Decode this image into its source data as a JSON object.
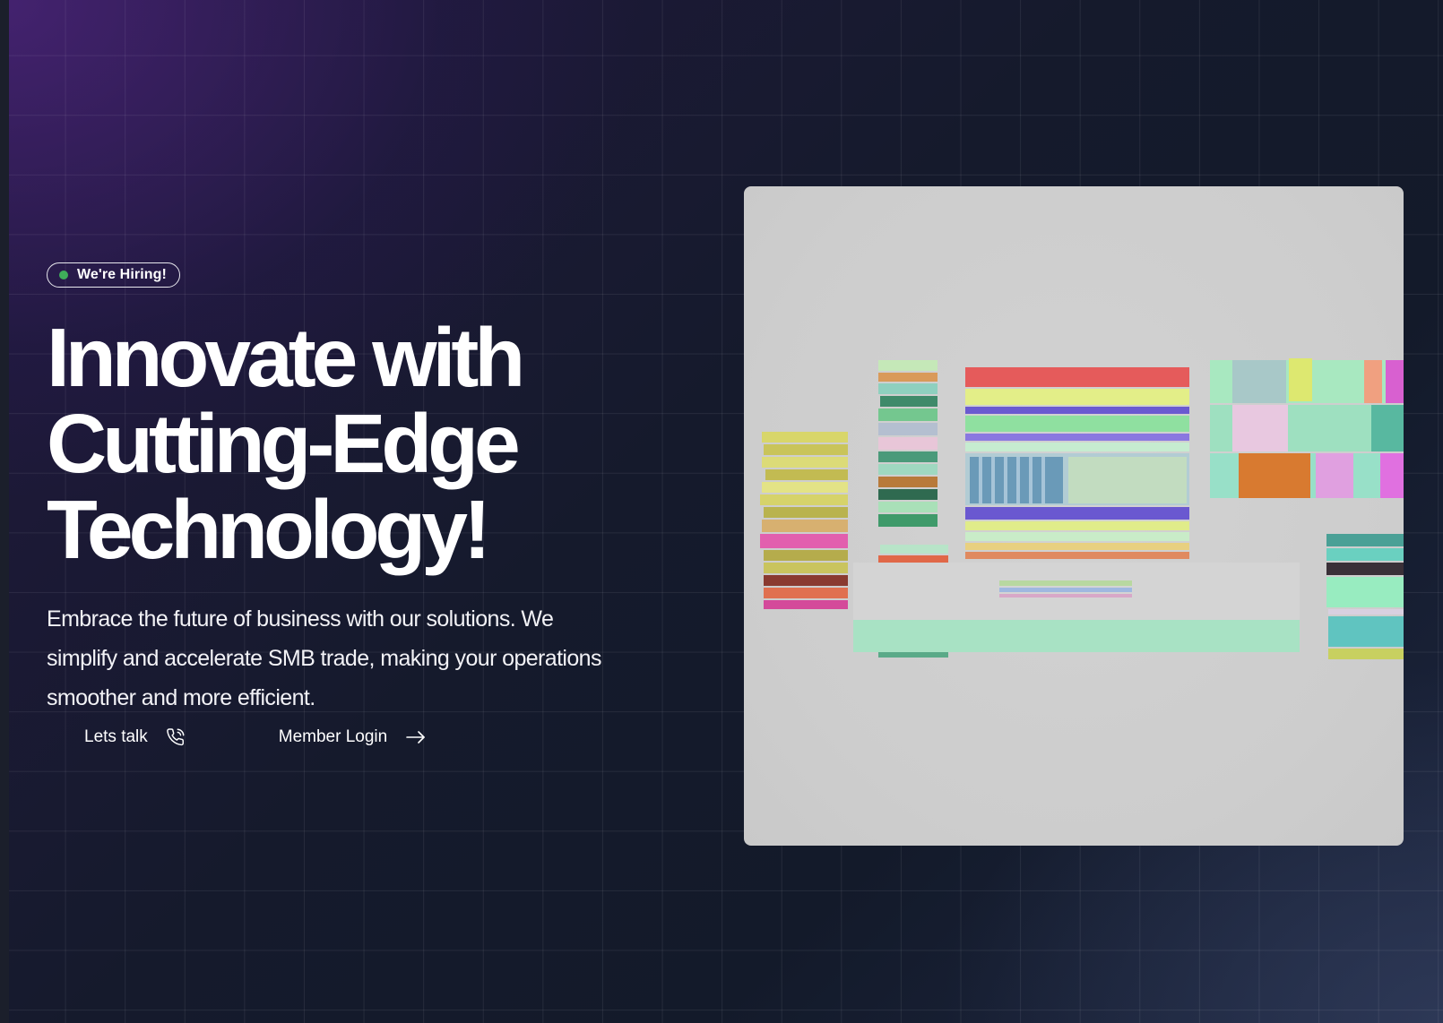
{
  "hero": {
    "badge_label": "We're Hiring!",
    "headline_lines": [
      "Innovate with",
      "Cutting-Edge",
      "Technology!"
    ],
    "subtitle": "Embrace the future of business with our solutions. We simplify and accelerate SMB trade, making your operations smoother and more efficient."
  },
  "actions": {
    "talk": {
      "label": "Lets talk",
      "icon": "phone-icon"
    },
    "login": {
      "label": "Member Login",
      "icon": "arrow-right-icon"
    }
  },
  "media": {
    "description_icon": "abstract-3d-blocks-illustration"
  },
  "colors": {
    "badge_dot": "#3fae5a",
    "text": "#ffffff",
    "background_dark": "#131a2a",
    "background_purple": "#2c1a4f",
    "card_background": "#cfcfcf"
  }
}
